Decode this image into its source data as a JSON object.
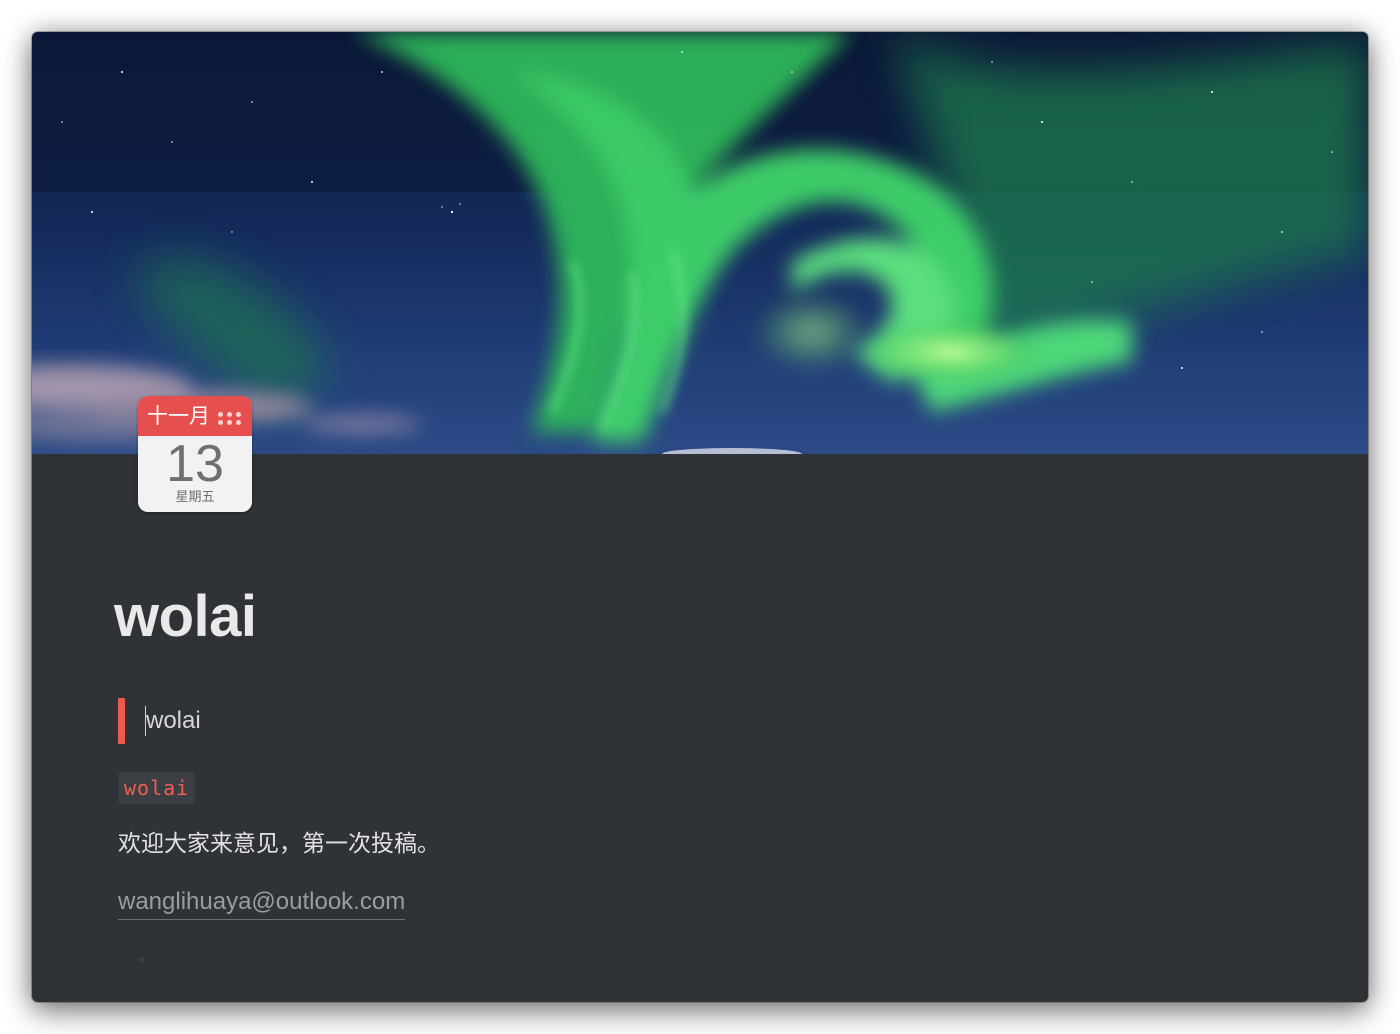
{
  "page": {
    "cover_image": "aurora-borealis-night-sky",
    "title": "wolai",
    "background_color": "#2f3337"
  },
  "page_icon": {
    "icon": "calendar-icon",
    "month": "十一月",
    "day": "13",
    "weekday": "星期五",
    "header_color": "#e5504f"
  },
  "blocks": {
    "quote": {
      "text": "wolai",
      "bar_color": "#ef5c4d"
    },
    "inline_code": {
      "text": "wolai",
      "color": "#f05e52"
    },
    "paragraph": {
      "text": "欢迎大家来意见，第一次投稿。"
    },
    "link": {
      "text": "wanglihuaya@outlook.com"
    }
  }
}
